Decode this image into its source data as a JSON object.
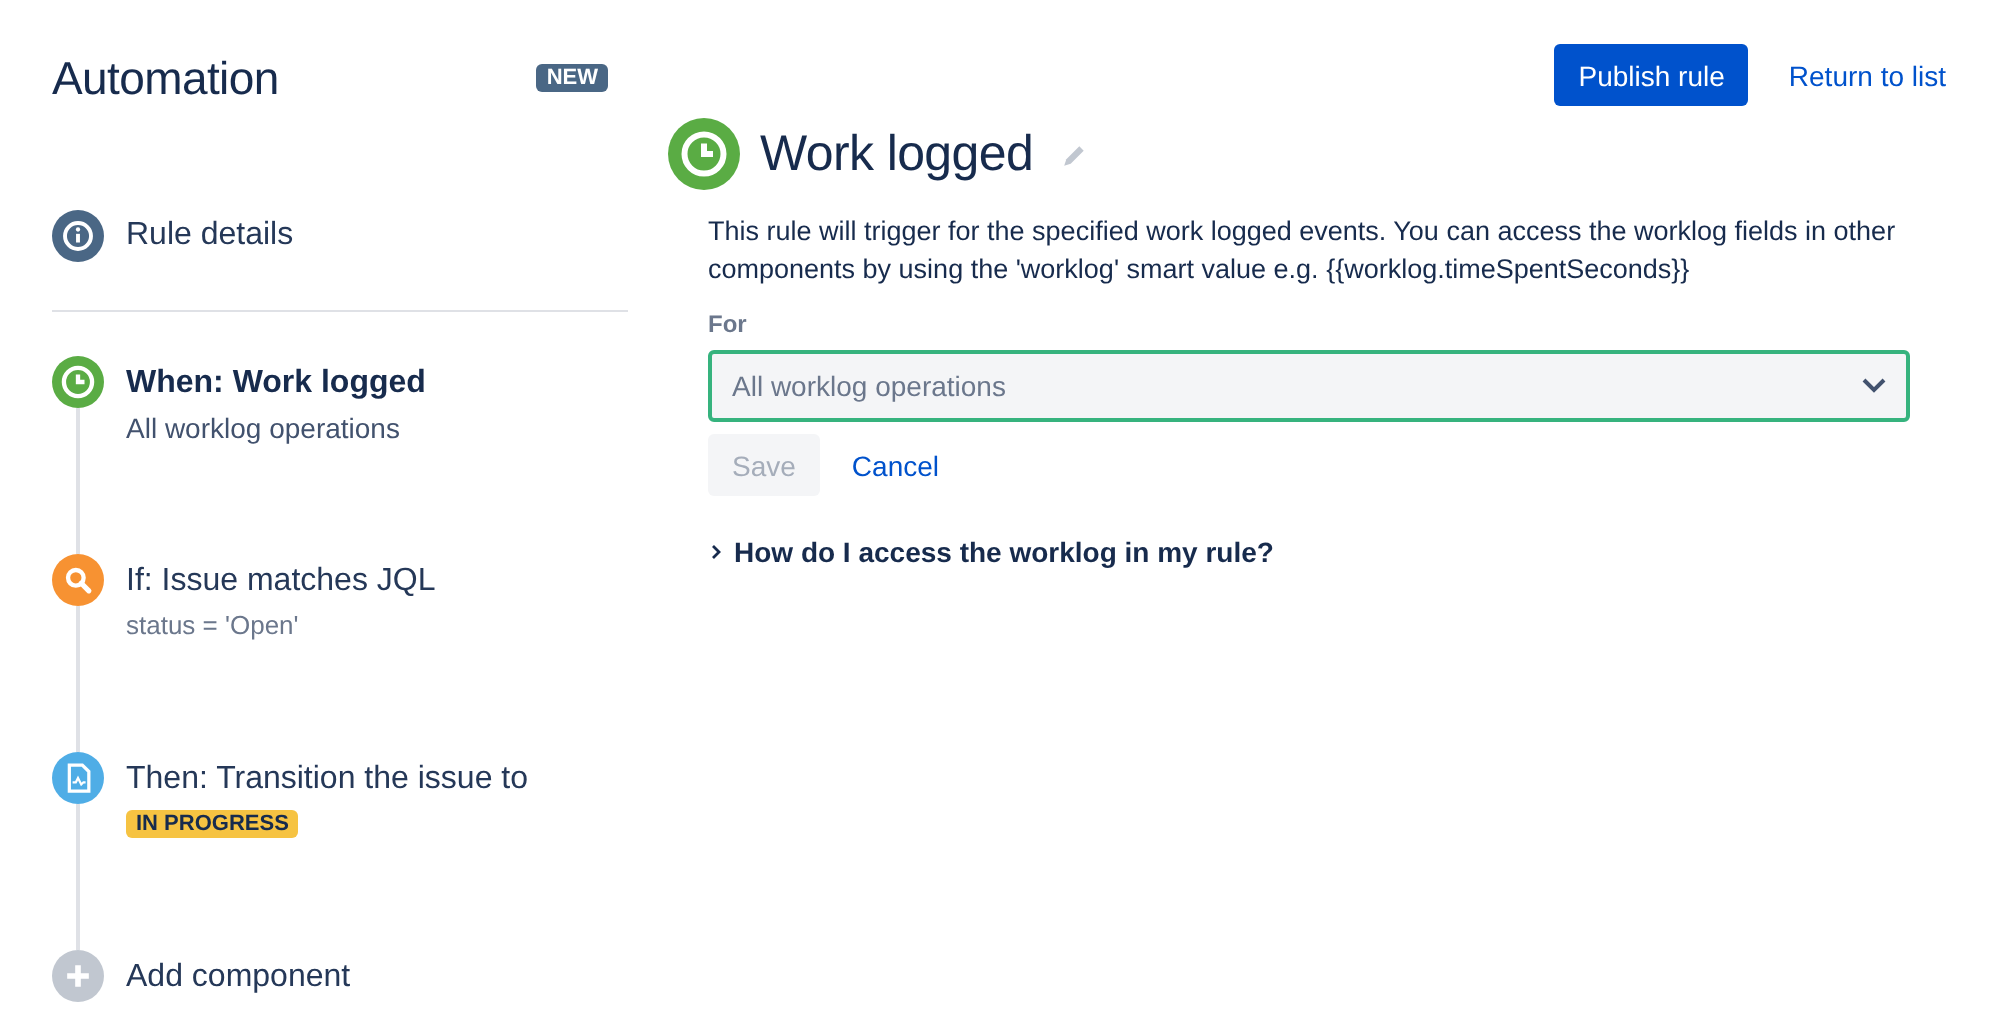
{
  "sidebar": {
    "title": "Automation",
    "badge": "NEW",
    "rule_details": {
      "label": "Rule details",
      "color": "#4a6785"
    },
    "steps": [
      {
        "kind": "trigger",
        "label": "When: Work logged",
        "detail": "All worklog operations",
        "color": "#5aac44",
        "selected": true
      },
      {
        "kind": "condition",
        "label": "If: Issue matches JQL",
        "detail": "status = 'Open'",
        "color": "#f79232",
        "selected": false
      },
      {
        "kind": "action",
        "label": "Then: Transition the issue to",
        "lozenge": "IN PROGRESS",
        "color": "#4fade6",
        "selected": false
      },
      {
        "kind": "add",
        "label": "Add component",
        "color": "#c1c7d0",
        "selected": false
      }
    ]
  },
  "header": {
    "publish": "Publish rule",
    "return": "Return to list"
  },
  "editor": {
    "title": "Work logged",
    "color": "#5aac44",
    "description": "This rule will trigger for the specified work logged events. You can access the worklog fields in other components by using the 'worklog' smart value e.g. {{worklog.timeSpentSeconds}}",
    "field_label": "For",
    "select_value": "All worklog operations",
    "save": {
      "label": "Save",
      "disabled": true
    },
    "cancel": "Cancel",
    "help": {
      "label": "How do I access the worklog in my rule?",
      "expanded": false
    }
  }
}
